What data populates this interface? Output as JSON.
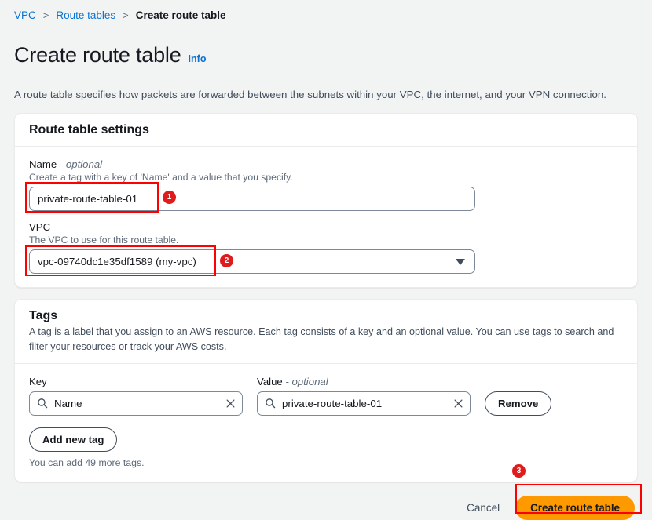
{
  "breadcrumb": {
    "items": [
      {
        "label": "VPC",
        "link": true
      },
      {
        "label": "Route tables",
        "link": true
      },
      {
        "label": "Create route table",
        "link": false
      }
    ],
    "separator": ">"
  },
  "header": {
    "title": "Create route table",
    "info_label": "Info",
    "description": "A route table specifies how packets are forwarded between the subnets within your VPC, the internet, and your VPN connection."
  },
  "settings_card": {
    "title": "Route table settings",
    "name_field": {
      "label": "Name",
      "optional_suffix": "- optional",
      "hint": "Create a tag with a key of 'Name' and a value that you specify.",
      "value": "private-route-table-01",
      "placeholder": ""
    },
    "vpc_field": {
      "label": "VPC",
      "hint": "The VPC to use for this route table.",
      "value": "vpc-09740dc1e35df1589 (my-vpc)"
    }
  },
  "tags_card": {
    "title": "Tags",
    "description": "A tag is a label that you assign to an AWS resource. Each tag consists of a key and an optional value. You can use tags to search and filter your resources or track your AWS costs.",
    "key_column_label": "Key",
    "value_column_label": "Value",
    "value_optional_suffix": "- optional",
    "rows": [
      {
        "key": "Name",
        "value": "private-route-table-01",
        "remove_label": "Remove"
      }
    ],
    "add_tag_label": "Add new tag",
    "tags_remaining_note": "You can add 49 more tags."
  },
  "footer": {
    "cancel_label": "Cancel",
    "submit_label": "Create route table"
  },
  "annotations": {
    "badges": [
      {
        "number": "1"
      },
      {
        "number": "2"
      },
      {
        "number": "3"
      }
    ]
  },
  "colors": {
    "page_background": "#f2f3f3",
    "link_blue": "#0972d3",
    "primary_orange": "#ff9900",
    "annotation_red": "#ff0000",
    "badge_red": "#e01b1b"
  }
}
